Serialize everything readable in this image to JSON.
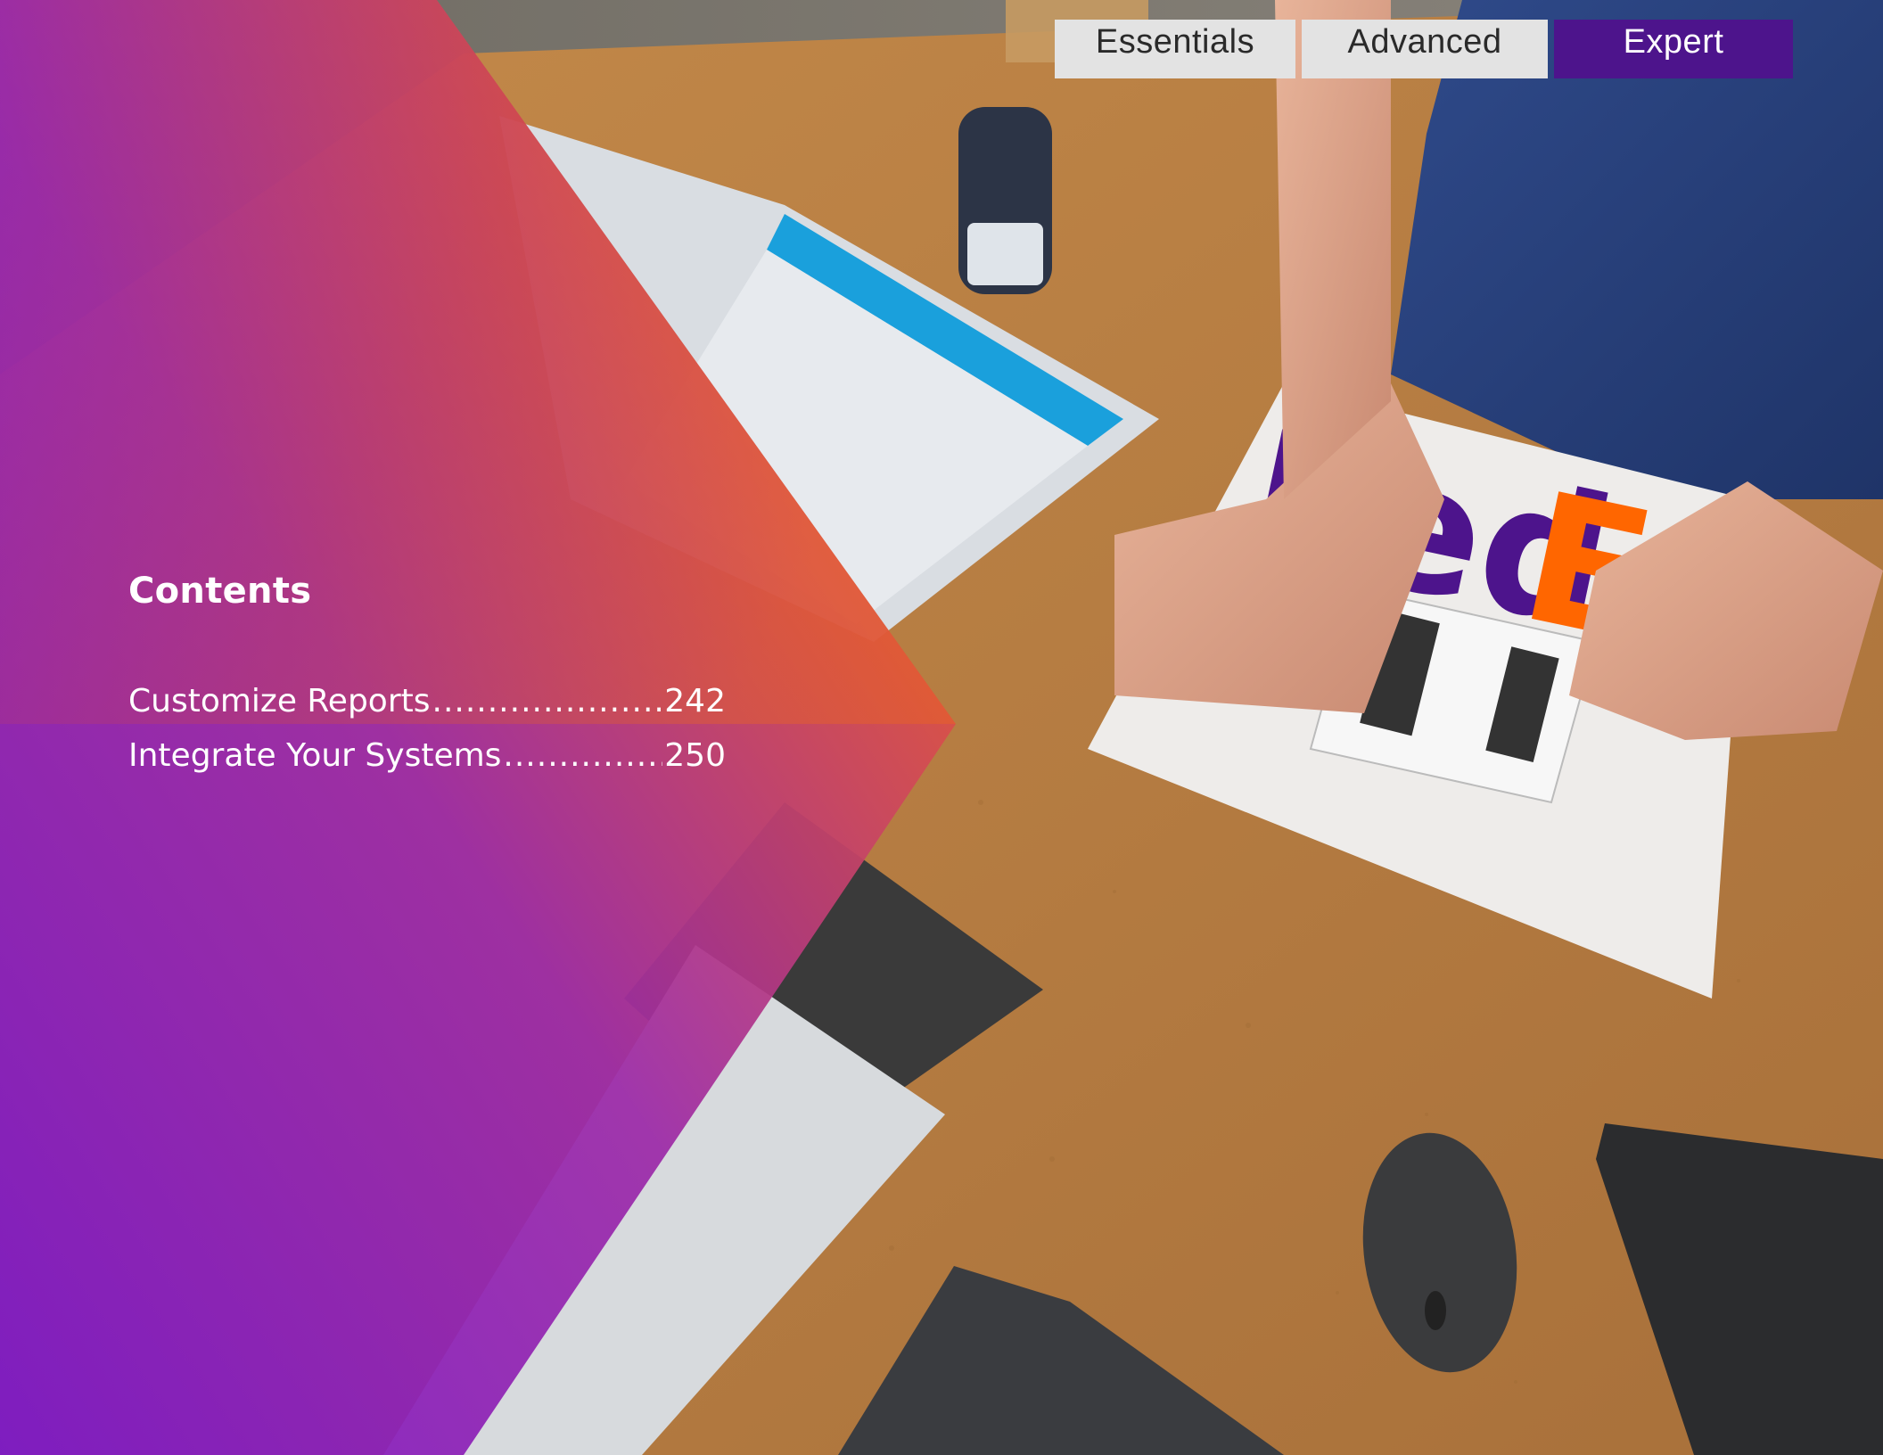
{
  "tabs": [
    {
      "label": "Essentials",
      "active": false
    },
    {
      "label": "Advanced",
      "active": false
    },
    {
      "label": "Expert",
      "active": true
    }
  ],
  "contents": {
    "title": "Contents",
    "entries": [
      {
        "label": "Customize Reports",
        "page": "242"
      },
      {
        "label": "Integrate Your Systems",
        "page": "250"
      }
    ]
  },
  "photo": {
    "subject": "packing-desk-photo",
    "package_brand": "FedEx"
  },
  "colors": {
    "overlay_purple": "#7a1ac8",
    "overlay_orange": "#f06a14",
    "tab_active": "#4d148c",
    "tab_inactive": "#e3e3e3",
    "fedex_purple": "#4d148c",
    "fedex_orange": "#ff6600",
    "desk": "#b8803f"
  }
}
